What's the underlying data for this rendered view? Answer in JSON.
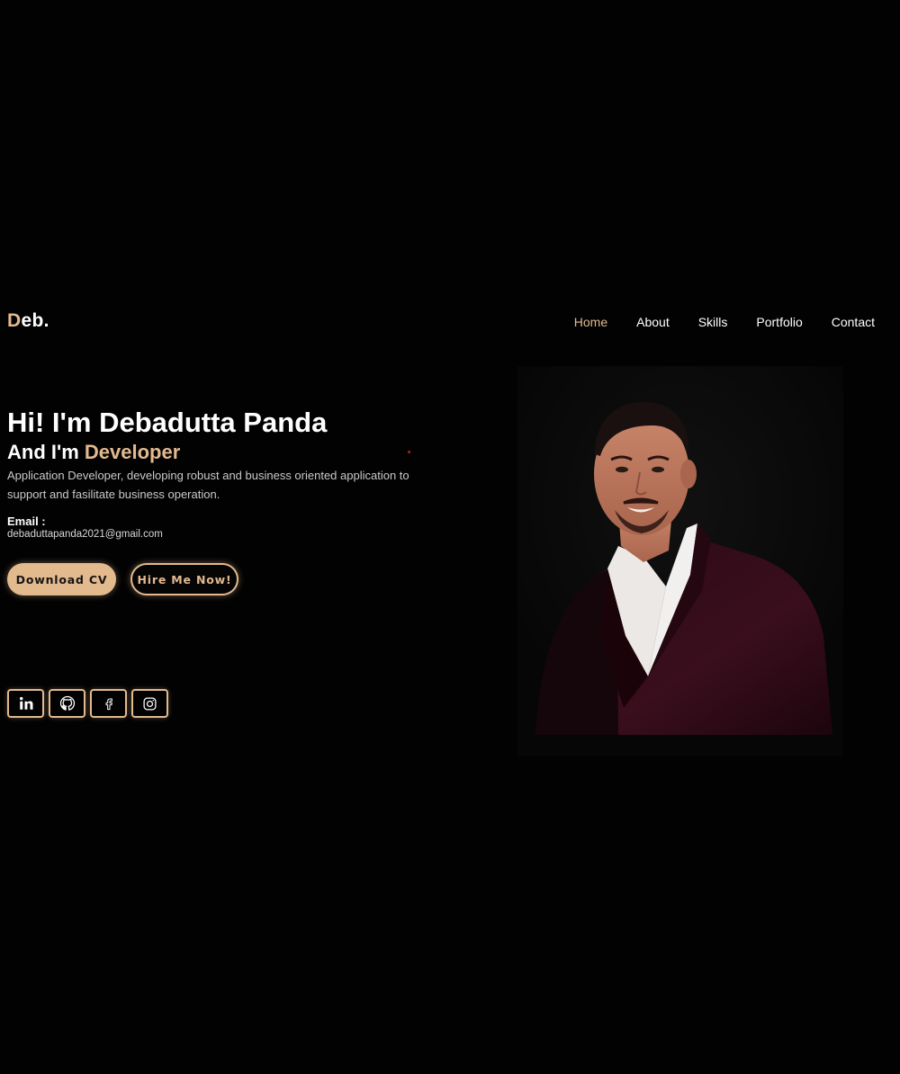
{
  "header": {
    "logo_initial": "D",
    "logo_rest": "eb.",
    "nav": [
      {
        "label": "Home",
        "active": true
      },
      {
        "label": "About",
        "active": false
      },
      {
        "label": "Skills",
        "active": false
      },
      {
        "label": "Portfolio",
        "active": false
      },
      {
        "label": "Contact",
        "active": false
      }
    ]
  },
  "hero": {
    "greeting": "Hi! I'm Debadutta Panda",
    "role_prefix": "And I'm ",
    "role": "Developer",
    "description": "Application Developer, developing robust and business oriented application to support and fasilitate business operation.",
    "email_label": "Email :",
    "email": "debaduttapanda2021@gmail.com"
  },
  "buttons": {
    "download_cv": "Download CV",
    "hire_me": "Hire Me Now!"
  },
  "socials": [
    {
      "icon": "linkedin-icon"
    },
    {
      "icon": "github-icon"
    },
    {
      "icon": "facebook-icon"
    },
    {
      "icon": "instagram-icon"
    }
  ],
  "colors": {
    "background": "#020202",
    "accent": "#e3b98e",
    "text": "#ffffff",
    "muted_text": "#c9c9c9"
  }
}
